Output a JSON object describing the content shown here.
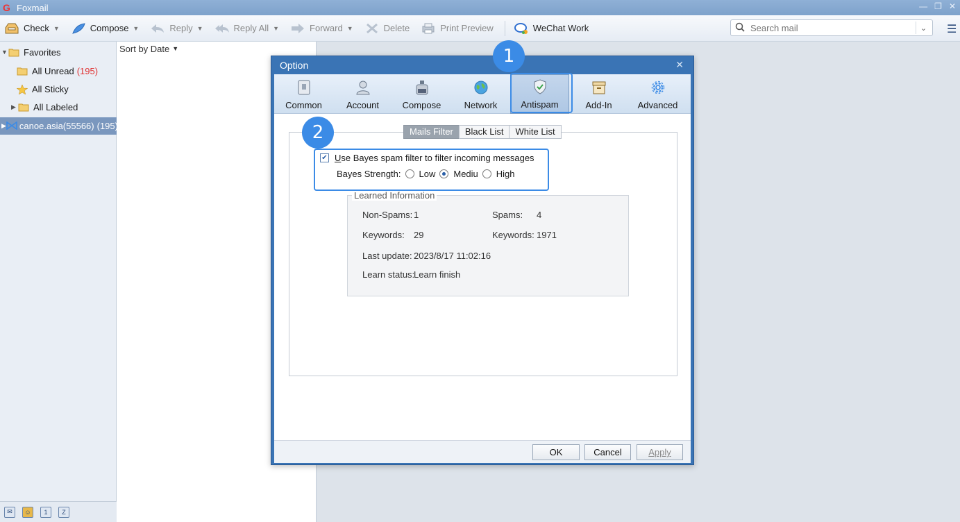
{
  "window": {
    "title": "Foxmail"
  },
  "toolbar": {
    "check": "Check",
    "compose": "Compose",
    "reply": "Reply",
    "reply_all": "Reply All",
    "forward": "Forward",
    "delete": "Delete",
    "print_preview": "Print Preview",
    "wechat_work": "WeChat Work",
    "search_placeholder": "Search mail"
  },
  "sidebar": {
    "favorites": "Favorites",
    "all_unread": "All Unread",
    "all_unread_count": "(195)",
    "all_sticky": "All Sticky",
    "all_labeled": "All Labeled",
    "account": "canoe.asia(55566)",
    "account_count": "(195)"
  },
  "maillist": {
    "sort_label": "Sort by Date"
  },
  "dialog": {
    "title": "Option",
    "tabs": [
      "Common",
      "Account",
      "Compose",
      "Network",
      "Antispam",
      "Add-In",
      "Advanced"
    ],
    "subtabs": [
      "Mails Filter",
      "Black List",
      "White List"
    ],
    "bayes_checkbox_label_underlined": "U",
    "bayes_checkbox_label_rest": "se Bayes spam filter to filter incoming messages",
    "bayes_strength_label": "Bayes Strength:",
    "strength_options": [
      "Low",
      "Mediu",
      "High"
    ],
    "strength_selected": "Mediu",
    "learned_title": "Learned Information",
    "non_spams_label": "Non-Spams:",
    "non_spams_value": "1",
    "spams_label": "Spams:",
    "spams_value": "4",
    "keywords_label": "Keywords:",
    "keywords_left_value": "29",
    "keywords_right_value": "1971",
    "last_update_label": "Last update:",
    "last_update_value": "2023/8/17 11:02:16",
    "learn_status_label": "Learn status:",
    "learn_status_value": "Learn finish",
    "ok": "OK",
    "cancel": "Cancel",
    "apply": "Apply"
  },
  "callouts": {
    "badge1": "1",
    "badge2": "2"
  },
  "colors": {
    "accent": "#3b8be6",
    "unread_count": "#e03030",
    "dialog_frame": "#3a74b5"
  }
}
